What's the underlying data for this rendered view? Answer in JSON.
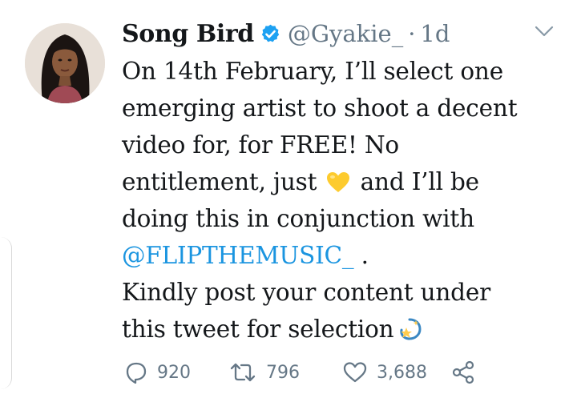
{
  "tweet": {
    "display_name": "Song Bird",
    "handle": "@Gyakie_",
    "separator": "·",
    "age": "1d",
    "lines": [
      "On 14th February, I’ll select one",
      "emerging artist to shoot a decent",
      "video for, for FREE! No"
    ],
    "line4_before": "entitlement, just",
    "line4_after": "and I’ll be",
    "line5": "doing this in conjunction with",
    "mention": "@FLIPTHEMUSIC_",
    "mention_after": " .",
    "line7": "Kindly post your content under",
    "line8": "this tweet for selection",
    "emojis": [
      "yellow-heart",
      "dizzy"
    ]
  },
  "actions": {
    "reply_count": "920",
    "retweet_count": "796",
    "like_count": "3,688"
  },
  "colors": {
    "text": "#14171a",
    "muted": "#657786",
    "link": "#1b95e0",
    "verified": "#1da1f2"
  }
}
